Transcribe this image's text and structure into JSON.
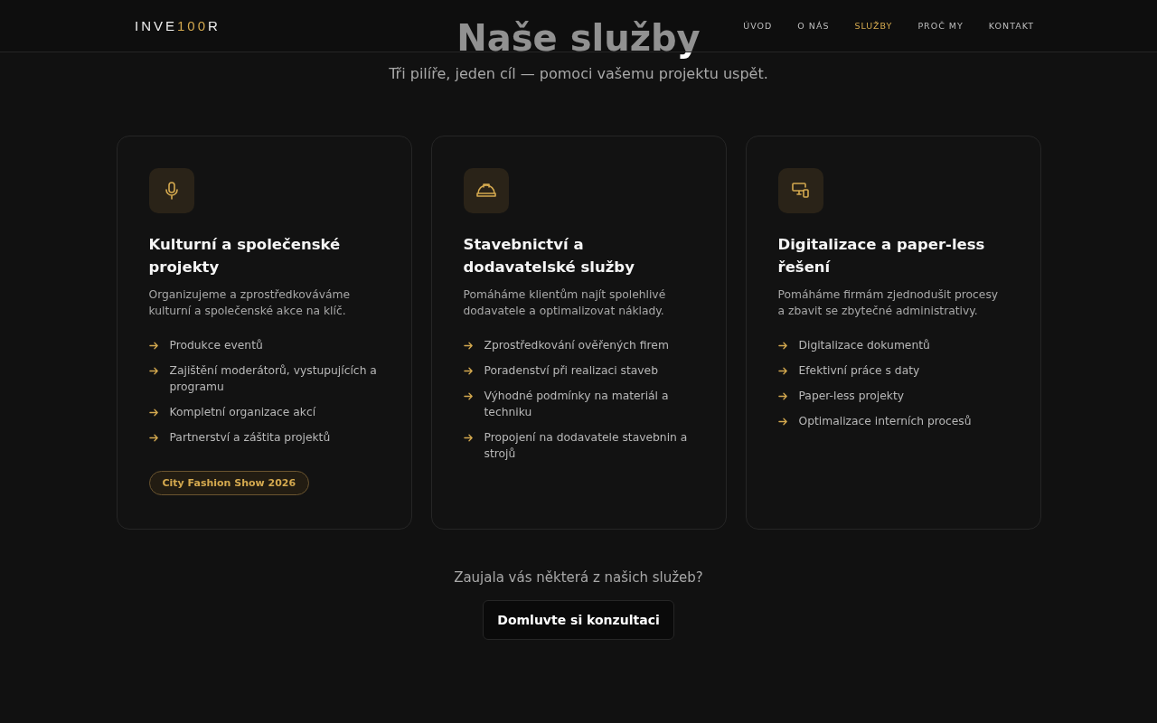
{
  "header": {
    "logo": [
      {
        "text": "INVE",
        "accent": false
      },
      {
        "text": "100",
        "accent": true
      },
      {
        "text": "R",
        "accent": false
      }
    ],
    "nav": [
      {
        "label": "ÚVOD",
        "selected": false
      },
      {
        "label": "O NÁS",
        "selected": false
      },
      {
        "label": "SLUŽBY",
        "selected": true
      },
      {
        "label": "PROČ MY",
        "selected": false
      },
      {
        "label": "KONTAKT",
        "selected": false
      }
    ]
  },
  "section": {
    "title": "Naše služby",
    "subtitle": "Tři pilíře, jeden cíl — pomoci vašemu projektu uspět."
  },
  "cards": [
    {
      "kind": "microphone",
      "title": "Kulturní a společenské projekty",
      "description": "Organizujeme a zprostředkováváme kulturní a společenské akce na klíč.",
      "items": [
        "Produkce eventů",
        "Zajištění moderátorů, vystupujících a programu",
        "Kompletní organizace akcí",
        "Partnerství a záštita projektů"
      ],
      "badge": "City Fashion Show 2026"
    },
    {
      "kind": "helmet",
      "title": "Stavebnictví a dodavatelské služby",
      "description": "Pomáháme klientům najít spolehlivé dodavatele a optimalizovat náklady.",
      "items": [
        "Zprostředkování ověřených firem",
        "Poradenství při realizaci staveb",
        "Výhodné podmínky na materiál a techniku",
        "Propojení na dodavatele stavebnin a strojů"
      ]
    },
    {
      "kind": "devices",
      "title": "Digitalizace a paper-less řešení",
      "description": "Pomáháme firmám zjednodušit procesy a zbavit se zbytečné administrativy.",
      "items": [
        "Digitalizace dokumentů",
        "Efektivní práce s daty",
        "Paper-less projekty",
        "Optimalizace interních procesů"
      ]
    }
  ],
  "cta": {
    "question": "Zaujala vás některá z našich služeb?",
    "button": "Domluvte si konzultaci"
  }
}
